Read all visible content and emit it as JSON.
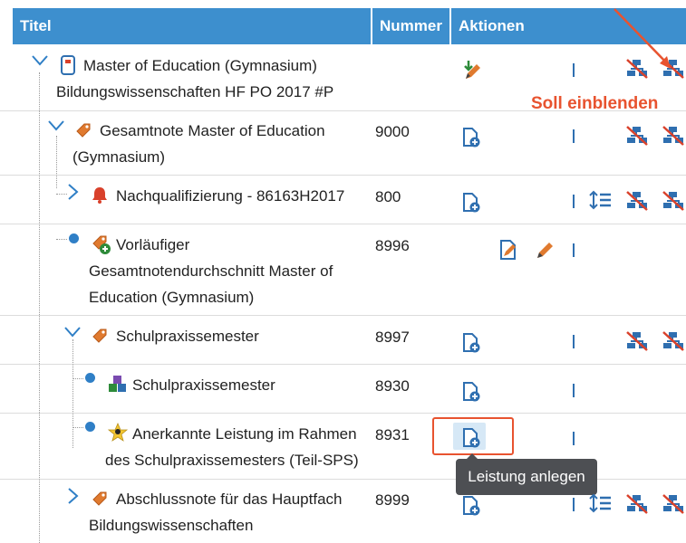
{
  "header": {
    "title": "Titel",
    "number": "Nummer",
    "actions": "Aktionen"
  },
  "rows": [
    {
      "line1": "Master of Education (Gymnasium)",
      "line2": "Bildungswissenschaften HF PO 2017 #P",
      "number": ""
    },
    {
      "line1": "Gesamtnote Master of Education",
      "line2": "(Gymnasium)",
      "number": "9000"
    },
    {
      "line1": "Nachqualifizierung - 86163H2017",
      "number": "800"
    },
    {
      "line1": "Vorläufiger",
      "line2": "Gesamtnotendurchschnitt Master of",
      "line3": "Education (Gymnasium)",
      "number": "8996"
    },
    {
      "line1": "Schulpraxissemester",
      "number": "8997"
    },
    {
      "line1": "Schulpraxissemester",
      "number": "8930"
    },
    {
      "line1": "Anerkannte Leistung im Rahmen",
      "line2": "des Schulpraxissemesters (Teil-SPS)",
      "number": "8931"
    },
    {
      "line1": "Abschlussnote für das Hauptfach",
      "line2": "Bildungswissenschaften",
      "number": "8999"
    }
  ],
  "tooltip": "Leistung anlegen",
  "annotation": "Soll einblenden",
  "colors": {
    "header": "#3d8fce",
    "icon_blue": "#2f6fb0",
    "icon_red": "#d9412b",
    "annotation": "#e8532f"
  }
}
